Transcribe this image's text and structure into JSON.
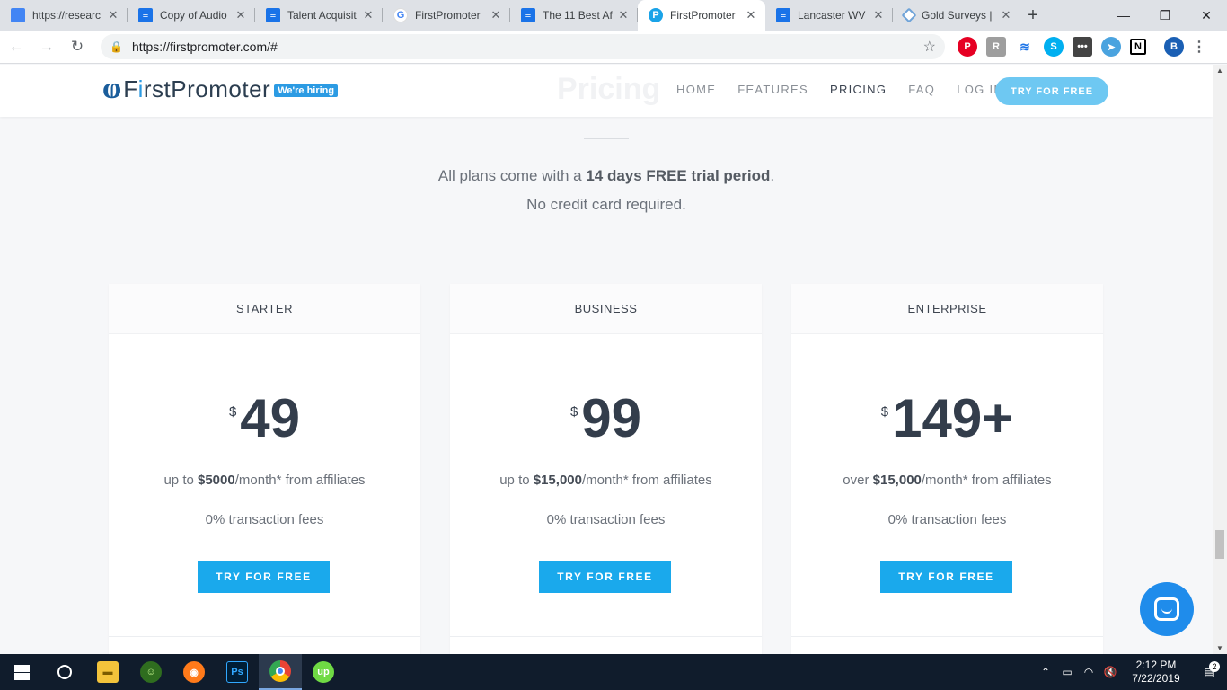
{
  "browser": {
    "tabs": [
      {
        "title": "https://researc",
        "icon": "doc-icon",
        "active": false
      },
      {
        "title": "Copy of Audio",
        "icon": "docs-icon",
        "active": false
      },
      {
        "title": "Talent Acquisit",
        "icon": "docs-icon",
        "active": false
      },
      {
        "title": "FirstPromoter",
        "icon": "google-icon",
        "active": false
      },
      {
        "title": "The 11 Best Af",
        "icon": "docs-icon",
        "active": false
      },
      {
        "title": "FirstPromoter",
        "icon": "firstpromoter-icon",
        "active": true
      },
      {
        "title": "Lancaster WV",
        "icon": "docs-icon",
        "active": false
      },
      {
        "title": "Gold Surveys |",
        "icon": "goldsurveys-icon",
        "active": false
      }
    ],
    "url": "https://firstpromoter.com/#",
    "profile_initial": "B"
  },
  "site": {
    "logo_prefix": "F",
    "logo_i": "i",
    "logo_rest": "rstPromoter",
    "hiring_badge": "We're hiring",
    "ghost_title": "Pricing",
    "nav": [
      {
        "label": "HOME",
        "active": false
      },
      {
        "label": "FEATURES",
        "active": false
      },
      {
        "label": "PRICING",
        "active": true
      },
      {
        "label": "FAQ",
        "active": false
      },
      {
        "label": "LOG IN",
        "active": false
      }
    ],
    "cta": "TRY FOR FREE"
  },
  "intro": {
    "line1_before": "All plans come with a ",
    "line1_bold": "14 days FREE trial period",
    "line1_after": ".",
    "line2": "No credit card required."
  },
  "plans": [
    {
      "name": "STARTER",
      "currency": "$",
      "price": "49",
      "limit_prefix": "up to ",
      "limit_bold": "$5000",
      "limit_suffix": "/month* from affiliates",
      "fees": "0% transaction fees",
      "button": "TRY FOR FREE"
    },
    {
      "name": "BUSINESS",
      "currency": "$",
      "price": "99",
      "limit_prefix": "up to ",
      "limit_bold": "$15,000",
      "limit_suffix": "/month* from affiliates",
      "fees": "0% transaction fees",
      "button": "TRY FOR FREE"
    },
    {
      "name": "ENTERPRISE",
      "currency": "$",
      "price": "149+",
      "limit_prefix": "over ",
      "limit_bold": "$15,000",
      "limit_suffix": "/month* from affiliates",
      "fees": "0% transaction fees",
      "button": "TRY FOR FREE"
    }
  ],
  "taskbar": {
    "time": "2:12 PM",
    "date": "7/22/2019",
    "notifications": "2"
  },
  "colors": {
    "accent": "#1aa9ec",
    "cta_light": "#6ec8f2",
    "text_dark": "#333d4b",
    "taskbar": "#101c2c"
  }
}
